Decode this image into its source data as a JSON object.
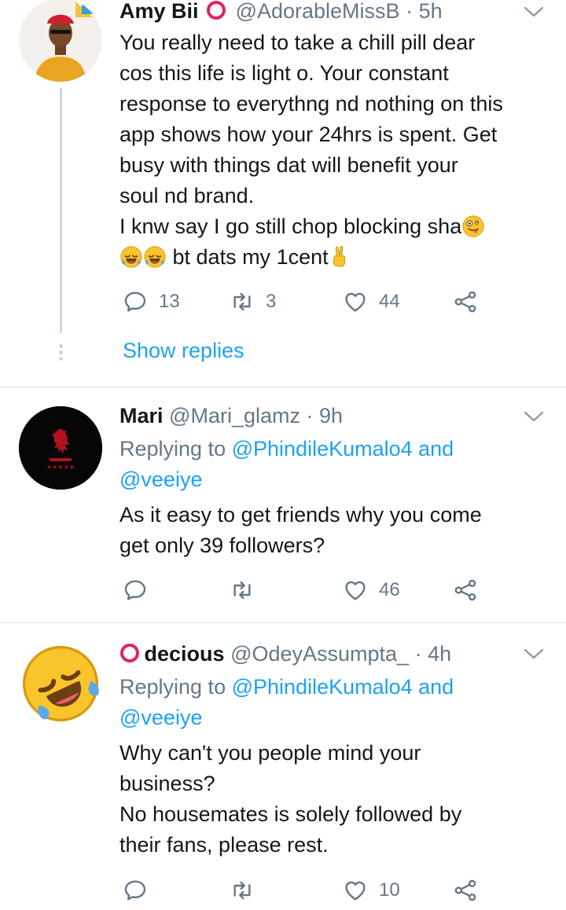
{
  "tweets": [
    {
      "name": "Amy Bii",
      "handle": "@AdorableMissB",
      "time": "· 5h",
      "lines": [
        "You really need to take a chill pill dear",
        "cos this life is light o. Your constant",
        "response to everythng nd nothing on this",
        "app shows how your 24hrs is spent. Get",
        "busy with things dat will benefit your",
        "soul nd brand."
      ],
      "line7": "I knw say I go still chop blocking sha",
      "line8": "bt dats my 1cent",
      "replies": "13",
      "retweets": "3",
      "likes": "44",
      "show_replies": "Show replies"
    },
    {
      "name": "Mari",
      "handle": "@Mari_glamz",
      "time": "· 9h",
      "replying_pre": "Replying to",
      "replying_users": "@PhindileKumalo4 and",
      "replying_users2": "@veeiye",
      "lines": [
        "As it easy to get friends why you come",
        "get only 39 followers?"
      ],
      "likes": "46"
    },
    {
      "name": "decious",
      "handle": "@OdeyAssumpta_",
      "time": "· 4h",
      "replying_pre": "Replying to",
      "replying_users": "@PhindileKumalo4 and",
      "replying_users2": "@veeiye",
      "lines": [
        "Why can't you people mind your",
        "business?",
        "No housemates is solely followed by",
        "their fans, please rest."
      ],
      "likes": "10"
    }
  ],
  "colors": {
    "accent": "#1da1f2",
    "muted": "#657786",
    "text": "#14171a",
    "badge_red": "#e0245e"
  },
  "icons": [
    "reply-icon",
    "retweet-icon",
    "like-icon",
    "share-icon",
    "chevron-down-icon"
  ]
}
